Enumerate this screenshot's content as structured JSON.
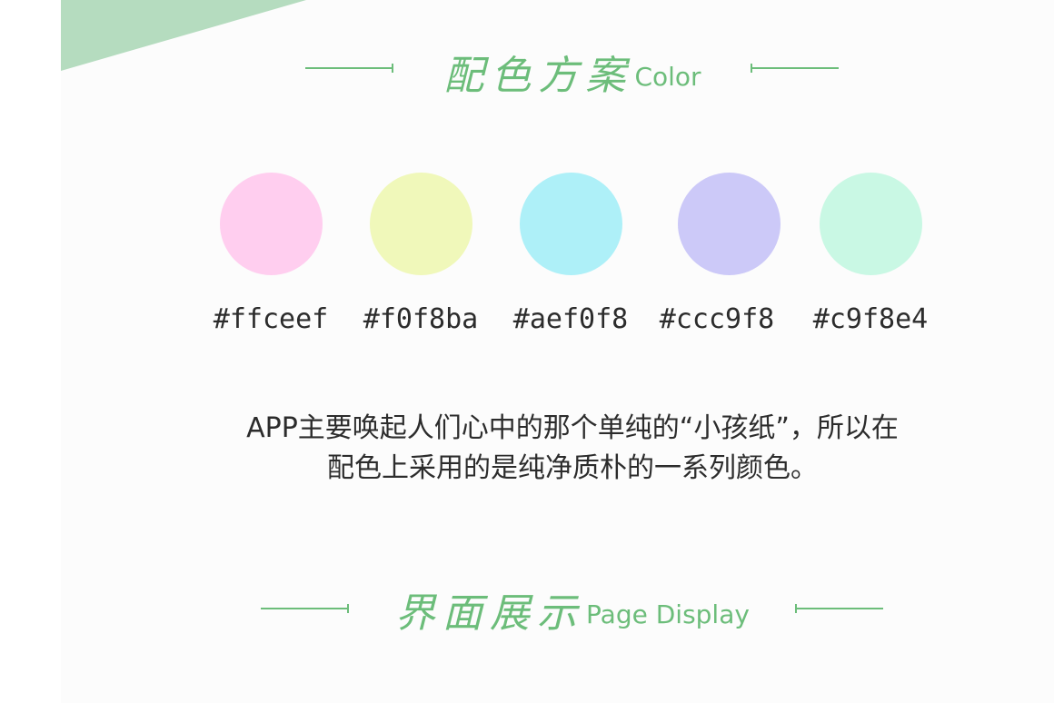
{
  "color_section": {
    "title_cn": "配色方案",
    "title_en": "Color"
  },
  "swatches": [
    {
      "hex": "#ffceef",
      "label": "#ffceef"
    },
    {
      "hex": "#f0f8ba",
      "label": "#f0f8ba"
    },
    {
      "hex": "#aef0f8",
      "label": "#aef0f8"
    },
    {
      "hex": "#ccc9f8",
      "label": "#ccc9f8"
    },
    {
      "hex": "#c9f8e4",
      "label": "#c9f8e4"
    }
  ],
  "description": {
    "line1": "APP主要唤起人们心中的那个单纯的“小孩纸”，所以在",
    "line2": "配色上采用的是纯净质朴的一系列颜色。"
  },
  "page_section": {
    "title_cn": "界面展示",
    "title_en": "Page Display"
  },
  "colors": {
    "accent": "#6cbd7a",
    "corner": "#b5dcbf"
  }
}
